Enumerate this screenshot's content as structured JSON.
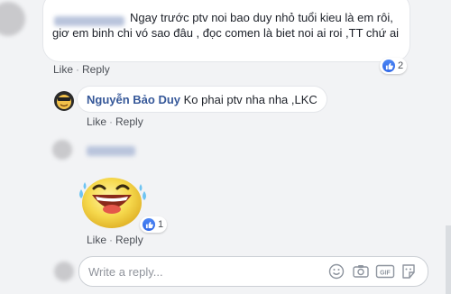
{
  "comment1": {
    "text": "Ngay trước ptv noi bao duy nhỏ tuổi kieu là em rôi, giơ em binh chi vó sao đâu , đọc comen là biet noi ai roi ,TT chứ ai",
    "reaction_count": "2",
    "like_label": "Like",
    "reply_label": "Reply"
  },
  "reply1": {
    "author": "Nguyễn Bảo Duy",
    "text": "Ko phai ptv nha nha ,LKC",
    "like_label": "Like",
    "reply_label": "Reply"
  },
  "reply2": {
    "reaction_count": "1",
    "like_label": "Like",
    "reply_label": "Reply",
    "sticker": "laughing-emoji-sticker"
  },
  "composer": {
    "placeholder": "Write a reply...",
    "icons": [
      "emoji-icon",
      "camera-icon",
      "gif-icon",
      "sticker-icon"
    ]
  },
  "colors": {
    "background": "#f2f3f5",
    "link": "#365899",
    "like_blue": "#2f67e6"
  }
}
